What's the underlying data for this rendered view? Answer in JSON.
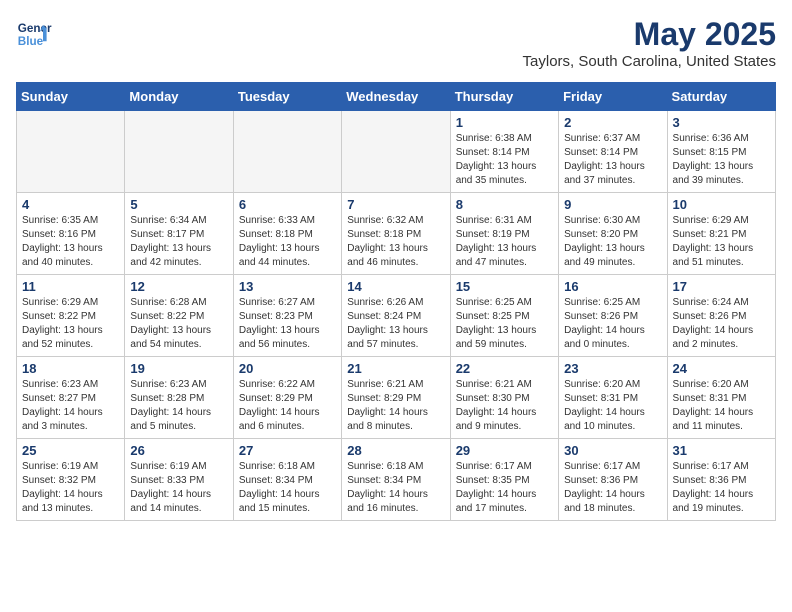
{
  "header": {
    "logo_line1": "General",
    "logo_line2": "Blue",
    "title": "May 2025",
    "subtitle": "Taylors, South Carolina, United States"
  },
  "weekdays": [
    "Sunday",
    "Monday",
    "Tuesday",
    "Wednesday",
    "Thursday",
    "Friday",
    "Saturday"
  ],
  "weeks": [
    [
      {
        "day": "",
        "empty": true
      },
      {
        "day": "",
        "empty": true
      },
      {
        "day": "",
        "empty": true
      },
      {
        "day": "",
        "empty": true
      },
      {
        "day": "1",
        "sunrise": "6:38 AM",
        "sunset": "8:14 PM",
        "daylight": "13 hours and 35 minutes."
      },
      {
        "day": "2",
        "sunrise": "6:37 AM",
        "sunset": "8:14 PM",
        "daylight": "13 hours and 37 minutes."
      },
      {
        "day": "3",
        "sunrise": "6:36 AM",
        "sunset": "8:15 PM",
        "daylight": "13 hours and 39 minutes."
      }
    ],
    [
      {
        "day": "4",
        "sunrise": "6:35 AM",
        "sunset": "8:16 PM",
        "daylight": "13 hours and 40 minutes."
      },
      {
        "day": "5",
        "sunrise": "6:34 AM",
        "sunset": "8:17 PM",
        "daylight": "13 hours and 42 minutes."
      },
      {
        "day": "6",
        "sunrise": "6:33 AM",
        "sunset": "8:18 PM",
        "daylight": "13 hours and 44 minutes."
      },
      {
        "day": "7",
        "sunrise": "6:32 AM",
        "sunset": "8:18 PM",
        "daylight": "13 hours and 46 minutes."
      },
      {
        "day": "8",
        "sunrise": "6:31 AM",
        "sunset": "8:19 PM",
        "daylight": "13 hours and 47 minutes."
      },
      {
        "day": "9",
        "sunrise": "6:30 AM",
        "sunset": "8:20 PM",
        "daylight": "13 hours and 49 minutes."
      },
      {
        "day": "10",
        "sunrise": "6:29 AM",
        "sunset": "8:21 PM",
        "daylight": "13 hours and 51 minutes."
      }
    ],
    [
      {
        "day": "11",
        "sunrise": "6:29 AM",
        "sunset": "8:22 PM",
        "daylight": "13 hours and 52 minutes."
      },
      {
        "day": "12",
        "sunrise": "6:28 AM",
        "sunset": "8:22 PM",
        "daylight": "13 hours and 54 minutes."
      },
      {
        "day": "13",
        "sunrise": "6:27 AM",
        "sunset": "8:23 PM",
        "daylight": "13 hours and 56 minutes."
      },
      {
        "day": "14",
        "sunrise": "6:26 AM",
        "sunset": "8:24 PM",
        "daylight": "13 hours and 57 minutes."
      },
      {
        "day": "15",
        "sunrise": "6:25 AM",
        "sunset": "8:25 PM",
        "daylight": "13 hours and 59 minutes."
      },
      {
        "day": "16",
        "sunrise": "6:25 AM",
        "sunset": "8:26 PM",
        "daylight": "14 hours and 0 minutes."
      },
      {
        "day": "17",
        "sunrise": "6:24 AM",
        "sunset": "8:26 PM",
        "daylight": "14 hours and 2 minutes."
      }
    ],
    [
      {
        "day": "18",
        "sunrise": "6:23 AM",
        "sunset": "8:27 PM",
        "daylight": "14 hours and 3 minutes."
      },
      {
        "day": "19",
        "sunrise": "6:23 AM",
        "sunset": "8:28 PM",
        "daylight": "14 hours and 5 minutes."
      },
      {
        "day": "20",
        "sunrise": "6:22 AM",
        "sunset": "8:29 PM",
        "daylight": "14 hours and 6 minutes."
      },
      {
        "day": "21",
        "sunrise": "6:21 AM",
        "sunset": "8:29 PM",
        "daylight": "14 hours and 8 minutes."
      },
      {
        "day": "22",
        "sunrise": "6:21 AM",
        "sunset": "8:30 PM",
        "daylight": "14 hours and 9 minutes."
      },
      {
        "day": "23",
        "sunrise": "6:20 AM",
        "sunset": "8:31 PM",
        "daylight": "14 hours and 10 minutes."
      },
      {
        "day": "24",
        "sunrise": "6:20 AM",
        "sunset": "8:31 PM",
        "daylight": "14 hours and 11 minutes."
      }
    ],
    [
      {
        "day": "25",
        "sunrise": "6:19 AM",
        "sunset": "8:32 PM",
        "daylight": "14 hours and 13 minutes."
      },
      {
        "day": "26",
        "sunrise": "6:19 AM",
        "sunset": "8:33 PM",
        "daylight": "14 hours and 14 minutes."
      },
      {
        "day": "27",
        "sunrise": "6:18 AM",
        "sunset": "8:34 PM",
        "daylight": "14 hours and 15 minutes."
      },
      {
        "day": "28",
        "sunrise": "6:18 AM",
        "sunset": "8:34 PM",
        "daylight": "14 hours and 16 minutes."
      },
      {
        "day": "29",
        "sunrise": "6:17 AM",
        "sunset": "8:35 PM",
        "daylight": "14 hours and 17 minutes."
      },
      {
        "day": "30",
        "sunrise": "6:17 AM",
        "sunset": "8:36 PM",
        "daylight": "14 hours and 18 minutes."
      },
      {
        "day": "31",
        "sunrise": "6:17 AM",
        "sunset": "8:36 PM",
        "daylight": "14 hours and 19 minutes."
      }
    ]
  ]
}
